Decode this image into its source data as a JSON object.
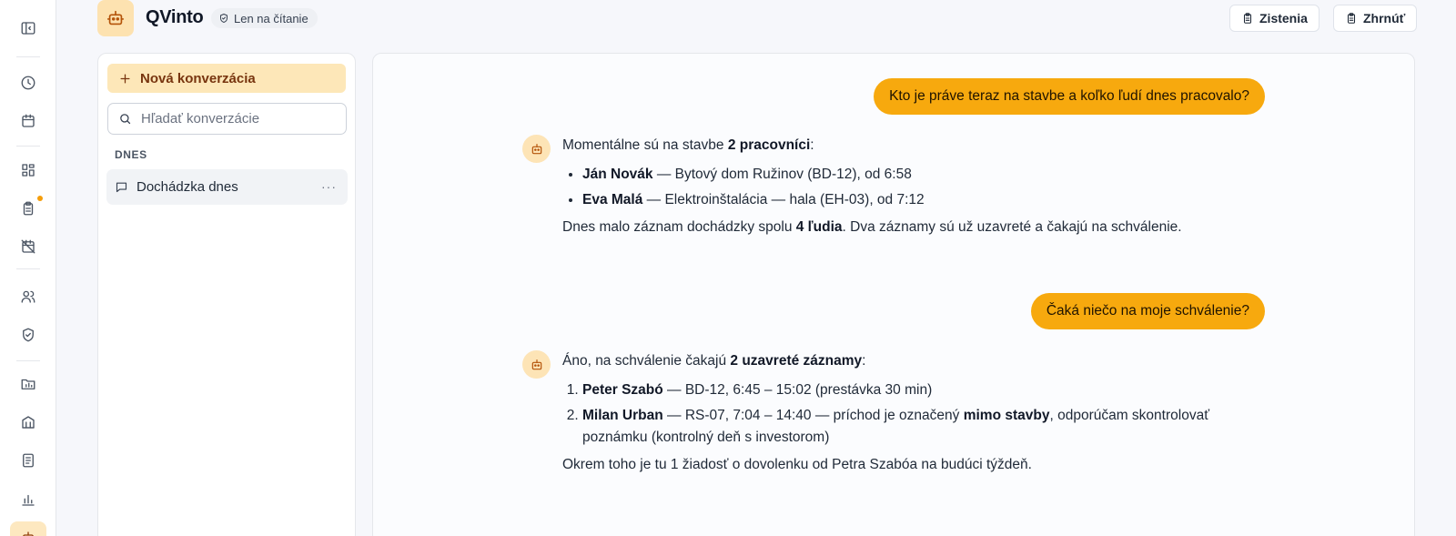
{
  "app": {
    "name": "QVinto",
    "badge": "Len na čítanie"
  },
  "header_actions": {
    "findings_label": "Zistenia",
    "summarize_label": "Zhrnúť"
  },
  "rail": {
    "items": [
      {
        "icon": "sidebar-toggle-icon"
      },
      {
        "icon": "clock-icon"
      },
      {
        "icon": "calendar-icon"
      },
      {
        "icon": "dashboard-icon"
      },
      {
        "icon": "clipboard-icon",
        "notification": true
      },
      {
        "icon": "calendar-off-icon"
      },
      {
        "icon": "users-icon"
      },
      {
        "icon": "shield-check-icon"
      },
      {
        "icon": "folder-chart-icon"
      },
      {
        "icon": "building-icon"
      },
      {
        "icon": "document-icon"
      },
      {
        "icon": "bar-chart-icon"
      },
      {
        "icon": "bot-icon",
        "active": true
      }
    ],
    "accent_color": "#f59e0b"
  },
  "sidebar": {
    "new_conversation_label": "Nová konverzácia",
    "search_placeholder": "Hľadať konverzácie",
    "group_label": "DNES",
    "conversations": [
      {
        "title": "Dochádzka dnes"
      }
    ]
  },
  "chat": {
    "messages": [
      {
        "role": "user",
        "text": "Kto je práve teraz na stavbe a koľko ľudí dnes pracovalo?"
      },
      {
        "role": "assistant",
        "intro": [
          "Momentálne sú na stavbe ",
          "2 pracovníci",
          ":"
        ],
        "list_type": "ul",
        "items": [
          {
            "name": "Ján Novák",
            "detail": " — Bytový dom Ružinov (BD-12), od 6:58"
          },
          {
            "name": "Eva Malá",
            "detail": " — Elektroinštalácia — hala (EH-03), od 7:12"
          }
        ],
        "outro": [
          "Dnes malo záznam dochádzky spolu ",
          "4 ľudia",
          ". Dva záznamy sú už uzavreté a čakajú na schválenie."
        ]
      },
      {
        "role": "user",
        "text": "Čaká niečo na moje schválenie?"
      },
      {
        "role": "assistant",
        "intro": [
          "Áno, na schválenie čakajú ",
          "2 uzavreté záznamy",
          ":"
        ],
        "list_type": "ol",
        "items": [
          {
            "name": "Peter Szabó",
            "detail": " — BD-12, 6:45 – 15:02 (prestávka 30 min)"
          },
          {
            "name": "Milan Urban",
            "detail": " — RS-07, 7:04 – 14:40 — príchod je označený ",
            "bold2": "mimo stavby",
            "detail2": ", odporúčam skontrolovať poznámku (kontrolný deň s investorom)"
          }
        ],
        "outro": [
          "Okrem toho je tu 1 žiadosť o dovolenku od Petra Szabóa na budúci týždeň.",
          "",
          ""
        ]
      }
    ],
    "user_bubble_color": "#f7a90e"
  }
}
